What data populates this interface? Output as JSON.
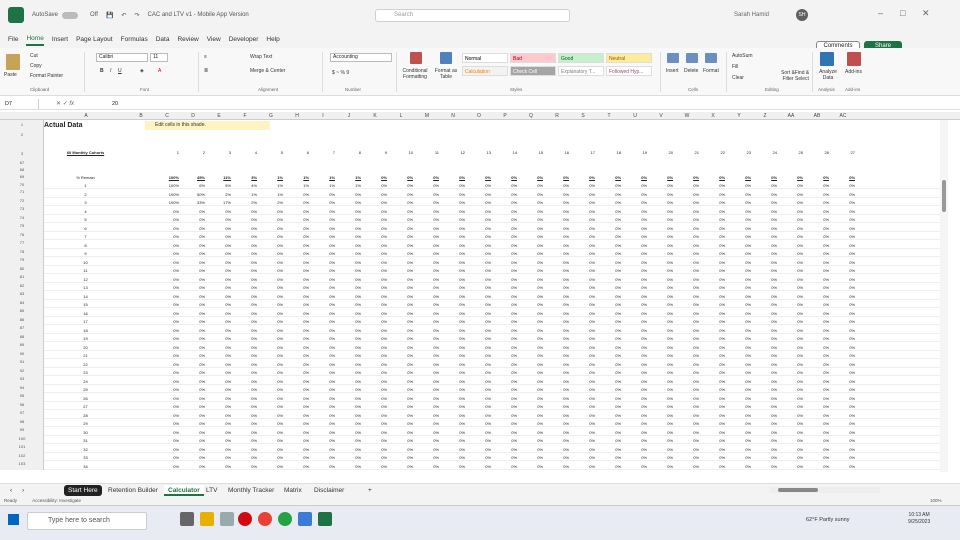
{
  "titlebar": {
    "autosave": "AutoSave",
    "toggle": "Off",
    "doc_title": "CAC and LTV v1 - Mobile App Version",
    "search_placeholder": "Search",
    "user": "Sarah Hamid",
    "user_initials": "SH"
  },
  "menu": [
    "File",
    "Home",
    "Insert",
    "Page Layout",
    "Formulas",
    "Data",
    "Review",
    "View",
    "Developer",
    "Help"
  ],
  "menu_active": "Home",
  "comments": "Comments",
  "share": "Share",
  "ribbon": {
    "clipboard": {
      "paste": "Paste",
      "cut": "Cut",
      "copy": "Copy",
      "format_painter": "Format Painter",
      "group": "Clipboard"
    },
    "font": {
      "name": "Calibri",
      "size": "11",
      "group": "Font"
    },
    "alignment": {
      "wrap": "Wrap Text",
      "merge": "Merge & Center",
      "group": "Alignment"
    },
    "number": {
      "format": "Accounting",
      "group": "Number"
    },
    "styles": {
      "cond": "Conditional Formatting",
      "table": "Format as Table",
      "cells": [
        {
          "label": "Normal",
          "bg": "#ffffff",
          "fg": "#000000"
        },
        {
          "label": "Bad",
          "bg": "#ffc7ce",
          "fg": "#9c0006"
        },
        {
          "label": "Good",
          "bg": "#c6efce",
          "fg": "#006100"
        },
        {
          "label": "Neutral",
          "bg": "#ffeb9c",
          "fg": "#9c5700"
        },
        {
          "label": "Calculation",
          "bg": "#f2f2f2",
          "fg": "#fa7d00"
        },
        {
          "label": "Check Cell",
          "bg": "#a5a5a5",
          "fg": "#ffffff"
        },
        {
          "label": "Explanatory T...",
          "bg": "#ffffff",
          "fg": "#7f7f7f"
        },
        {
          "label": "Followed Hyp...",
          "bg": "#ffffff",
          "fg": "#954f72"
        }
      ],
      "group": "Styles"
    },
    "cells": {
      "insert": "Insert",
      "delete": "Delete",
      "format": "Format",
      "group": "Cells"
    },
    "editing": {
      "autosum": "AutoSum",
      "fill": "Fill",
      "clear": "Clear",
      "sort": "Sort & Filter",
      "find": "Find & Select",
      "group": "Editing"
    },
    "analysis": {
      "analyze": "Analyze Data",
      "group": "Analysis"
    },
    "addins": {
      "label": "Add-ins",
      "group": "Add-ins"
    }
  },
  "formula": {
    "namebox": "D7",
    "fx": "fx",
    "value": "20"
  },
  "columns": [
    "A",
    "B",
    "C",
    "D",
    "E",
    "F",
    "G",
    "H",
    "I",
    "J",
    "K",
    "L",
    "M",
    "N",
    "O",
    "P",
    "Q",
    "R",
    "S",
    "T",
    "U",
    "V",
    "W",
    "X",
    "Y",
    "Z",
    "AA",
    "AB",
    "AC"
  ],
  "sheet": {
    "title": "Actual Data",
    "shade_note": "Edit cells in this shade.",
    "cohorts_label": "60 Monthly Cohorts",
    "pct_label": "% Remain",
    "cohort_numbers": [
      "1",
      "2",
      "3",
      "4",
      "5",
      "6",
      "7",
      "8",
      "9",
      "10",
      "11",
      "12",
      "13",
      "14",
      "15",
      "16",
      "17",
      "18",
      "19",
      "20",
      "21",
      "22",
      "23",
      "24",
      "25",
      "26",
      "27"
    ],
    "header_row": [
      "100%",
      "45%",
      "11%",
      "3%",
      "1%",
      "1%",
      "1%",
      "1%",
      "0%",
      "0%",
      "0%",
      "0%",
      "0%",
      "0%",
      "0%",
      "0%",
      "0%",
      "0%",
      "0%",
      "0%",
      "0%",
      "0%",
      "0%",
      "0%",
      "0%",
      "0%",
      "0%"
    ],
    "first_rows": [
      [
        "100%",
        "6%",
        "5%",
        "4%",
        "1%",
        "1%",
        "1%",
        "1%",
        "0%"
      ],
      [
        "100%",
        "50%",
        "2%",
        "1%",
        "1%",
        "0%",
        "0%",
        "0%",
        "0%"
      ],
      [
        "100%",
        "33%",
        "17%",
        "2%",
        "2%",
        "0%",
        "0%",
        "0%",
        "0%"
      ]
    ],
    "row_headers": [
      "1",
      "2",
      "3",
      "67",
      "68",
      "69",
      "70",
      "71",
      "72",
      "73",
      "74",
      "75",
      "76",
      "77",
      "78",
      "79",
      "80",
      "81",
      "82",
      "83",
      "84",
      "85",
      "86",
      "87",
      "88",
      "89",
      "90",
      "91",
      "92",
      "93",
      "94",
      "95",
      "96",
      "97",
      "98",
      "99",
      "100",
      "101",
      "102",
      "103",
      "104"
    ],
    "cohort_rows": [
      "1",
      "2",
      "3",
      "4",
      "5",
      "6",
      "7",
      "8",
      "9",
      "10",
      "11",
      "12",
      "13",
      "14",
      "15",
      "16",
      "17",
      "18",
      "19",
      "20",
      "21",
      "22",
      "23",
      "24",
      "25",
      "26",
      "27",
      "28",
      "29",
      "30",
      "31",
      "32",
      "33",
      "34",
      "35"
    ],
    "zero": "0%"
  },
  "tabs": [
    "Start Here",
    "Retention Builder",
    "Calculator",
    "LTV",
    "Monthly Tracker",
    "Matrix",
    "Disclaimer"
  ],
  "tab_active": "Calculator",
  "tab_add": "+",
  "status": {
    "ready": "Ready",
    "accessibility": "Accessibility: Investigate",
    "zoom": "100%"
  },
  "taskbar": {
    "search": "Type here to search",
    "weather": "62°F Partly sunny",
    "time": "10:13 AM",
    "date": "9/25/2023"
  }
}
